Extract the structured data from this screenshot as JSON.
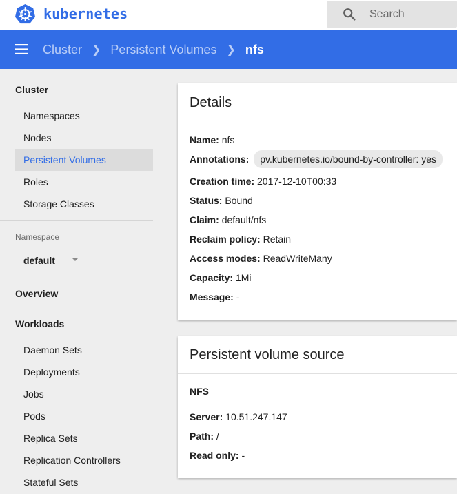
{
  "app": {
    "brand": "kubernetes",
    "search_placeholder": "Search"
  },
  "breadcrumb": [
    {
      "label": "Cluster"
    },
    {
      "label": "Persistent Volumes"
    },
    {
      "label": "nfs"
    }
  ],
  "sidebar": {
    "cluster_heading": "Cluster",
    "cluster_items": [
      {
        "label": "Namespaces"
      },
      {
        "label": "Nodes"
      },
      {
        "label": "Persistent Volumes",
        "active": true
      },
      {
        "label": "Roles"
      },
      {
        "label": "Storage Classes"
      }
    ],
    "namespace_label": "Namespace",
    "namespace_value": "default",
    "overview_heading": "Overview",
    "workloads_heading": "Workloads",
    "workload_items": [
      {
        "label": "Daemon Sets"
      },
      {
        "label": "Deployments"
      },
      {
        "label": "Jobs"
      },
      {
        "label": "Pods"
      },
      {
        "label": "Replica Sets"
      },
      {
        "label": "Replication Controllers"
      },
      {
        "label": "Stateful Sets"
      }
    ]
  },
  "details": {
    "title": "Details",
    "name_key": "Name:",
    "name_val": "nfs",
    "annotations_key": "Annotations:",
    "annotations_val": "pv.kubernetes.io/bound-by-controller: yes",
    "creation_key": "Creation time:",
    "creation_val": "2017-12-10T00:33",
    "status_key": "Status:",
    "status_val": "Bound",
    "claim_key": "Claim:",
    "claim_val": "default/nfs",
    "reclaim_key": "Reclaim policy:",
    "reclaim_val": "Retain",
    "access_key": "Access modes:",
    "access_val": "ReadWriteMany",
    "capacity_key": "Capacity:",
    "capacity_val": "1Mi",
    "message_key": "Message:",
    "message_val": "-"
  },
  "source": {
    "title": "Persistent volume source",
    "subtitle": "NFS",
    "server_key": "Server:",
    "server_val": "10.51.247.147",
    "path_key": "Path:",
    "path_val": "/",
    "readonly_key": "Read only:",
    "readonly_val": "-"
  },
  "colors": {
    "brand": "#326de6",
    "active_bg": "#dcdcdc"
  }
}
